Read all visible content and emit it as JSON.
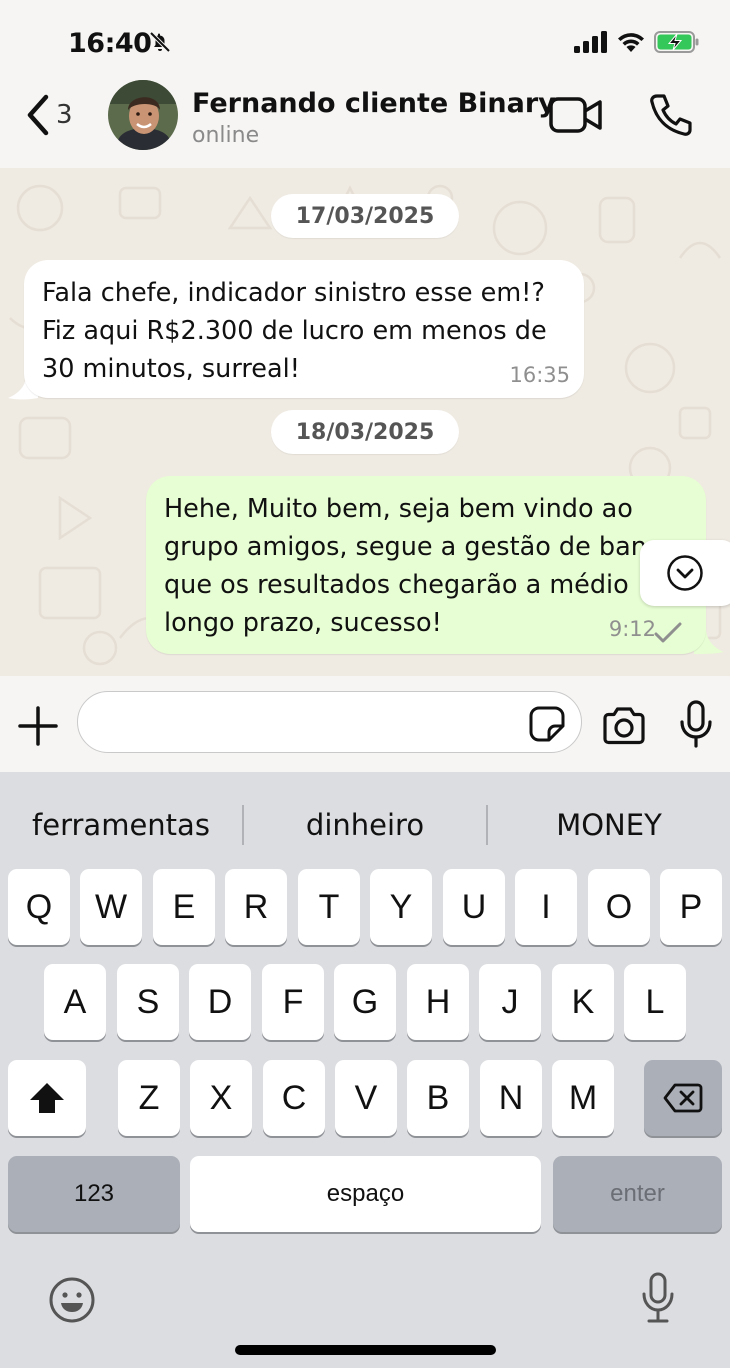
{
  "status_bar": {
    "time": "16:40"
  },
  "header": {
    "back_count": "3",
    "contact_name": "Fernando cliente Binary",
    "contact_status": "online"
  },
  "chat": {
    "date_1": "17/03/2025",
    "message_1": {
      "lines": [
        "Fala chefe, indicador sinistro esse em!?",
        "Fiz aqui R$2.300 de lucro em menos de",
        "30 minutos, surreal!"
      ],
      "time": "16:35"
    },
    "date_2": "18/03/2025",
    "message_2": {
      "lines": [
        "Hehe, Muito bem, seja bem vindo ao",
        "grupo amigos, segue a gestão de banca",
        "que os resultados chegarão a médio",
        "longo prazo, sucesso!"
      ],
      "time": "9:12"
    }
  },
  "input": {
    "value": "",
    "placeholder": ""
  },
  "keyboard": {
    "suggestions": [
      "ferramentas",
      "dinheiro",
      "MONEY"
    ],
    "row1": [
      "Q",
      "W",
      "E",
      "R",
      "T",
      "Y",
      "U",
      "I",
      "O",
      "P"
    ],
    "row2": [
      "A",
      "S",
      "D",
      "F",
      "G",
      "H",
      "J",
      "K",
      "L"
    ],
    "row3": [
      "Z",
      "X",
      "C",
      "V",
      "B",
      "N",
      "M"
    ],
    "numbers_label": "123",
    "space_label": "espaço",
    "enter_label": "enter"
  },
  "colors": {
    "incoming_bubble": "#ffffff",
    "outgoing_bubble": "#e7fdd3",
    "chat_background": "#efeae2",
    "battery_green": "#34c759"
  },
  "icons": [
    "bell-slash-icon",
    "signal-icon",
    "wifi-icon",
    "battery-charging-icon",
    "chevron-left-icon",
    "video-camera-icon",
    "phone-icon",
    "double-check-icon",
    "chevron-down-icon",
    "plus-icon",
    "sticker-icon",
    "camera-icon",
    "microphone-icon",
    "shift-icon",
    "backspace-icon",
    "emoji-icon"
  ]
}
